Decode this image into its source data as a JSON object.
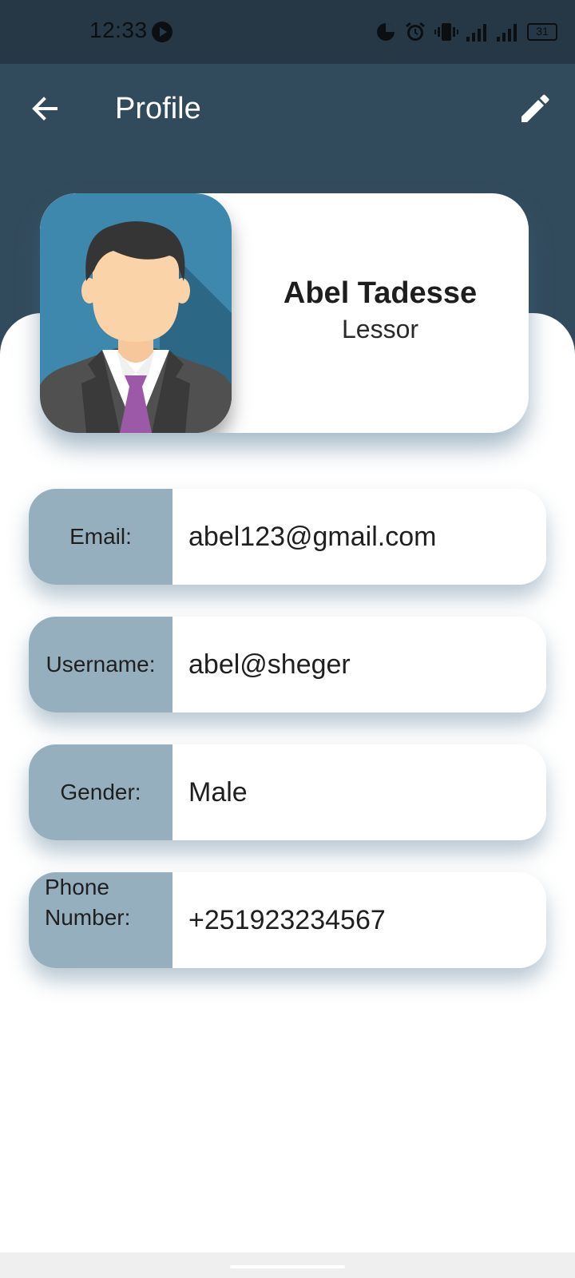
{
  "status_bar": {
    "time": "12:33",
    "battery": "31",
    "icons": [
      "play-icon",
      "data-usage-icon",
      "alarm-icon",
      "vibrate-icon",
      "signal-icon",
      "signal-icon",
      "battery-icon"
    ]
  },
  "app_bar": {
    "title": "Profile",
    "back_icon": "arrow-left-icon",
    "edit_icon": "pencil-icon"
  },
  "profile": {
    "name": "Abel Tadesse",
    "role": "Lessor"
  },
  "details": {
    "email_label": "Email:",
    "email_value": "abel123@gmail.com",
    "username_label": "Username:",
    "username_value": "abel@sheger",
    "gender_label": "Gender:",
    "gender_value": "Male",
    "phone_label_line1": "Phone",
    "phone_label_line2": "Number:",
    "phone_value": "+251923234567"
  },
  "colors": {
    "status_bar": "#263845",
    "app_bar": "#324b5c",
    "label_bg": "#96afbf",
    "avatar_bg": "#3e87ad",
    "tie": "#9b59a8"
  }
}
